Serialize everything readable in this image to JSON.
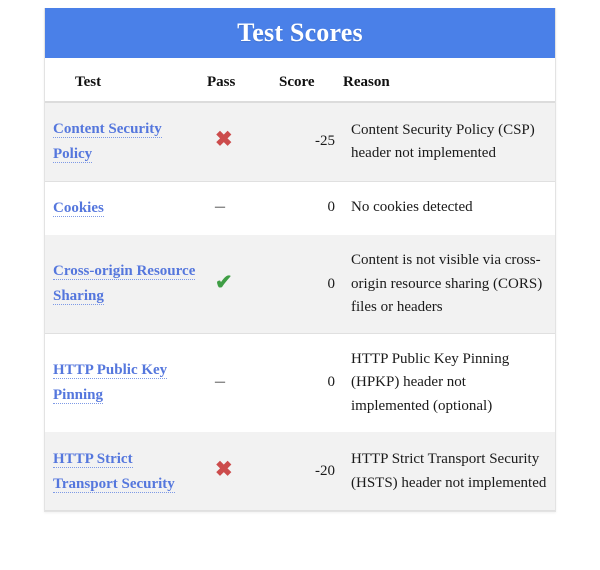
{
  "card": {
    "title": "Test Scores",
    "header_bg": "#4a80e8",
    "title_color": "#ffffff"
  },
  "colors": {
    "link": "#5577dd",
    "fail": "#cc4c4c",
    "pass": "#3f9e45",
    "neutral": "#8a8a8a",
    "stripe": "#f2f2f2"
  },
  "table": {
    "columns": {
      "test": "Test",
      "pass": "Pass",
      "score": "Score",
      "reason": "Reason"
    },
    "rows": [
      {
        "test": "Content Security Policy",
        "status_icon": "cross-icon",
        "status": "fail",
        "status_glyph": "✖",
        "score": "-25",
        "reason": "Content Security Policy (CSP) header not implemented"
      },
      {
        "test": "Cookies",
        "status_icon": "dash-icon",
        "status": "neutral",
        "status_glyph": "–",
        "score": "0",
        "reason": "No cookies detected"
      },
      {
        "test": "Cross-origin Resource Sharing",
        "status_icon": "check-icon",
        "status": "pass",
        "status_glyph": "✔",
        "score": "0",
        "reason": "Content is not visible via cross-origin resource sharing (CORS) files or headers"
      },
      {
        "test": "HTTP Public Key Pinning",
        "status_icon": "dash-icon",
        "status": "neutral",
        "status_glyph": "–",
        "score": "0",
        "reason": "HTTP Public Key Pinning (HPKP) header not implemented (optional)"
      },
      {
        "test": "HTTP Strict Transport Security",
        "status_icon": "cross-icon",
        "status": "fail",
        "status_glyph": "✖",
        "score": "-20",
        "reason": "HTTP Strict Transport Security (HSTS) header not implemented"
      }
    ]
  }
}
